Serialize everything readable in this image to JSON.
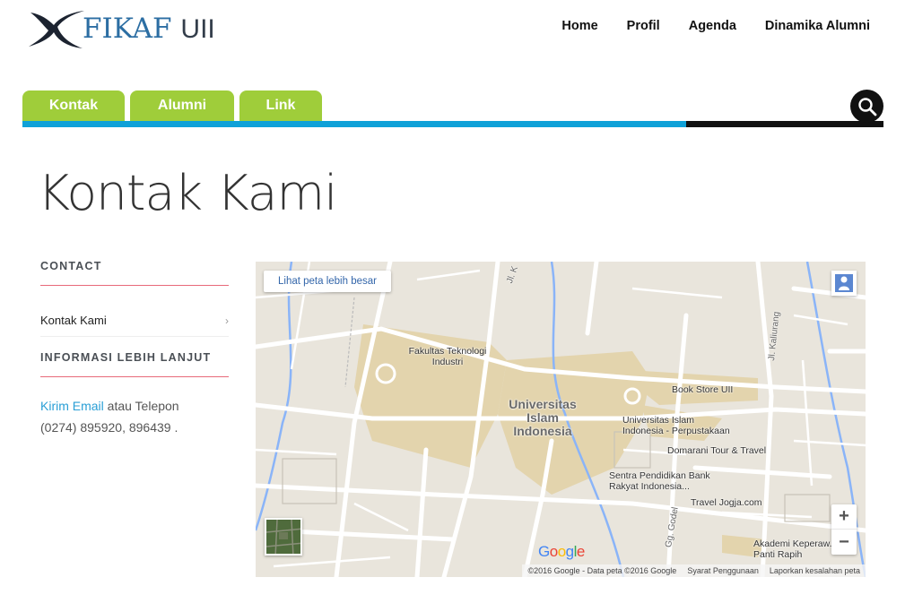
{
  "brand": {
    "name_part1": "FIKAF",
    "name_part2": "UII"
  },
  "topnav": [
    "Home",
    "Profil",
    "Agenda",
    "Dinamika Alumni"
  ],
  "tabs": [
    "Kontak",
    "Alumni",
    "Link"
  ],
  "page_title": "Kontak Kami",
  "sidebar": {
    "contact_heading": "CONTACT",
    "contact_item": "Kontak Kami",
    "info_heading": "INFORMASI LEBIH LANJUT",
    "email_link": "Kirim Email",
    "phone_text_pre": " atau Telepon",
    "phone_numbers": "(0274) 895920, 896439 ."
  },
  "map": {
    "view_larger": "Lihat peta lebih besar",
    "labels": {
      "fakultas": "Fakultas Teknologi Industri",
      "university": "Universitas Islam Indonesia",
      "bookstore": "Book Store UII",
      "perpustakaan": "Universitas Islam Indonesia - Perpustakaan",
      "domarani": "Domarani Tour & Travel",
      "sentra": "Sentra Pendidikan Bank Rakyat Indonesia...",
      "traveljogja": "Travel Jogja.com",
      "akademi": "Akademi Keperaw... Panti Rapih",
      "jl_kaliurang": "Jl. Kaliurang",
      "gg_godel": "Gg. Godel",
      "jl_k": "Jl. K"
    },
    "footer": {
      "copyright": "©2016 Google - Data peta ©2016 Google",
      "terms": "Syarat Penggunaan",
      "report": "Laporkan kesalahan peta"
    },
    "google_logo": "Google",
    "zoom_in": "+",
    "zoom_out": "−"
  },
  "colors": {
    "tab_green": "#9fcd3a",
    "bar_blue": "#0fa1d8",
    "link_blue": "#2a9fd6",
    "rule_pink": "#e86a7a"
  }
}
